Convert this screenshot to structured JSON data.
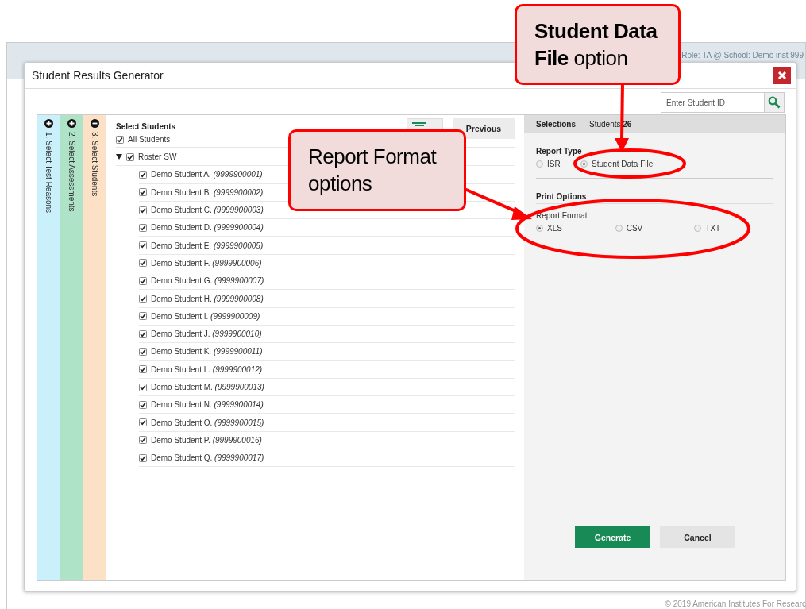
{
  "background_page": {
    "header_role": "Role: TA @ School: Demo inst 999",
    "footer": "© 2019 American Institutes For Researc"
  },
  "dialog": {
    "title": "Student Results Generator",
    "search": {
      "placeholder": "Enter Student ID"
    },
    "steps": [
      {
        "label": "1. Select Test Reasons",
        "expanded": false,
        "color": "#c9f0fb"
      },
      {
        "label": "2. Select Assessments",
        "expanded": false,
        "color": "#aee3c8"
      },
      {
        "label": "3. Select Students",
        "expanded": true,
        "color": "#fde1c6"
      }
    ],
    "select_students": {
      "title": "Select Students",
      "all": {
        "label": "All Students",
        "checked": true
      },
      "roster": {
        "label": "Roster SW",
        "checked": true,
        "expanded": true,
        "children": [
          {
            "name": "Demo Student A.",
            "id": "(9999900001)",
            "checked": true
          },
          {
            "name": "Demo Student B.",
            "id": "(9999900002)",
            "checked": true
          },
          {
            "name": "Demo Student C.",
            "id": "(9999900003)",
            "checked": true
          },
          {
            "name": "Demo Student D.",
            "id": "(9999900004)",
            "checked": true
          },
          {
            "name": "Demo Student E.",
            "id": "(9999900005)",
            "checked": true
          },
          {
            "name": "Demo Student F.",
            "id": "(9999900006)",
            "checked": true
          },
          {
            "name": "Demo Student G.",
            "id": "(9999900007)",
            "checked": true
          },
          {
            "name": "Demo Student H.",
            "id": "(9999900008)",
            "checked": true
          },
          {
            "name": "Demo Student I.",
            "id": "(9999900009)",
            "checked": true
          },
          {
            "name": "Demo Student J.",
            "id": "(9999900010)",
            "checked": true
          },
          {
            "name": "Demo Student K.",
            "id": "(9999900011)",
            "checked": true
          },
          {
            "name": "Demo Student L.",
            "id": "(9999900012)",
            "checked": true
          },
          {
            "name": "Demo Student M.",
            "id": "(9999900013)",
            "checked": true
          },
          {
            "name": "Demo Student N.",
            "id": "(9999900014)",
            "checked": true
          },
          {
            "name": "Demo Student O.",
            "id": "(9999900015)",
            "checked": true
          },
          {
            "name": "Demo Student P.",
            "id": "(9999900016)",
            "checked": true
          },
          {
            "name": "Demo Student Q.",
            "id": "(9999900017)",
            "checked": true
          }
        ]
      }
    },
    "previous_button": "Previous",
    "selections": {
      "label": "Selections",
      "students_label": "Students",
      "students_count": "26"
    },
    "report_type": {
      "title": "Report Type",
      "options": [
        {
          "label": "ISR",
          "selected": false
        },
        {
          "label": "Student Data File",
          "selected": true
        }
      ]
    },
    "print_options": {
      "title": "Print Options",
      "report_format": {
        "label": "Report Format",
        "options": [
          {
            "label": "XLS",
            "selected": true
          },
          {
            "label": "CSV",
            "selected": false
          },
          {
            "label": "TXT",
            "selected": false
          }
        ]
      }
    },
    "buttons": [
      {
        "label": "Generate",
        "kind": "primary"
      },
      {
        "label": "Cancel",
        "kind": "secondary"
      }
    ]
  },
  "callouts": [
    {
      "text": "**Student Data File** option"
    },
    {
      "text": "Report Format options"
    }
  ]
}
